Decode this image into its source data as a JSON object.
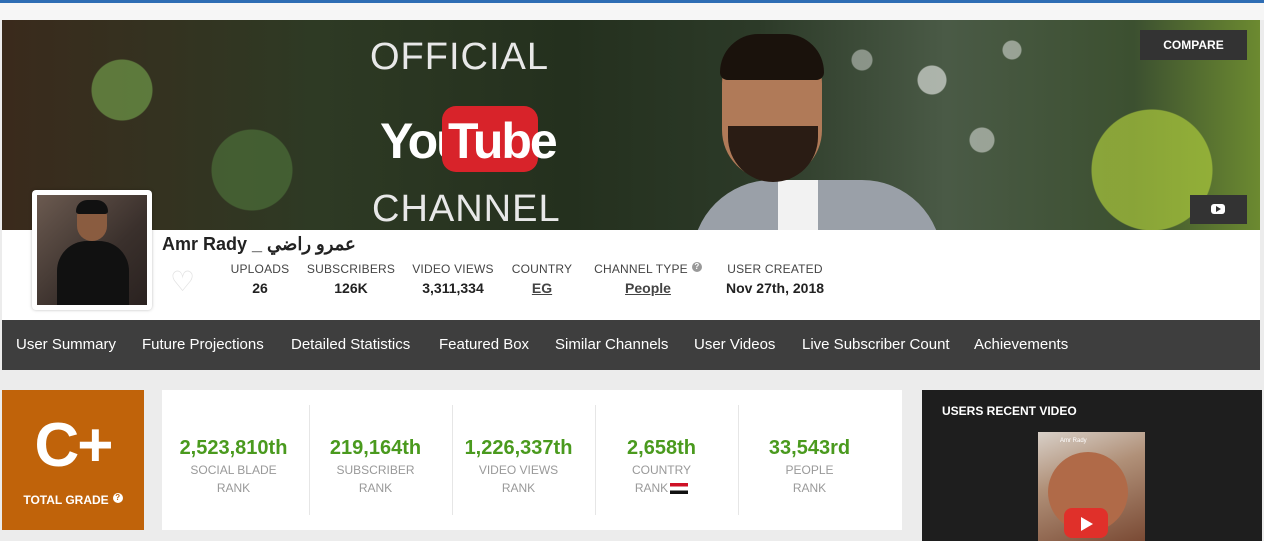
{
  "banner": {
    "line1": "OFFICIAL",
    "you": "You",
    "tube": "Tube",
    "line3": "CHANNEL",
    "compare_label": "COMPARE"
  },
  "channel": {
    "name": "Amr Rady _ عمرو راضي",
    "stats": [
      {
        "label": "UPLOADS",
        "value": "26"
      },
      {
        "label": "SUBSCRIBERS",
        "value": "126K"
      },
      {
        "label": "VIDEO VIEWS",
        "value": "3,311,334"
      },
      {
        "label": "COUNTRY",
        "value": "EG"
      },
      {
        "label": "CHANNEL TYPE",
        "value": "People"
      },
      {
        "label": "USER CREATED",
        "value": "Nov 27th, 2018"
      }
    ]
  },
  "nav": {
    "items": [
      "User Summary",
      "Future Projections",
      "Detailed Statistics",
      "Featured Box",
      "Similar Channels",
      "User Videos",
      "Live Subscriber Count",
      "Achievements"
    ]
  },
  "grade": {
    "value": "C+",
    "label": "TOTAL GRADE"
  },
  "ranks": [
    {
      "value": "2,523,810th",
      "line1": "SOCIAL BLADE",
      "line2": "RANK"
    },
    {
      "value": "219,164th",
      "line1": "SUBSCRIBER",
      "line2": "RANK"
    },
    {
      "value": "1,226,337th",
      "line1": "VIDEO VIEWS",
      "line2": "RANK"
    },
    {
      "value": "2,658th",
      "line1": "COUNTRY",
      "line2": "RANK"
    },
    {
      "value": "33,543rd",
      "line1": "PEOPLE",
      "line2": "RANK"
    }
  ],
  "recent_video": {
    "title": "USERS RECENT VIDEO",
    "thumb_title": "Amr Rady"
  },
  "colors": {
    "accent_green": "#4a9a1e",
    "grade_orange": "#c0630a",
    "nav_bg": "#3e3e3e"
  },
  "icons": {
    "heart": "heart-icon",
    "help": "question-icon",
    "youtube": "youtube-icon",
    "flag": "egypt-flag-icon"
  }
}
